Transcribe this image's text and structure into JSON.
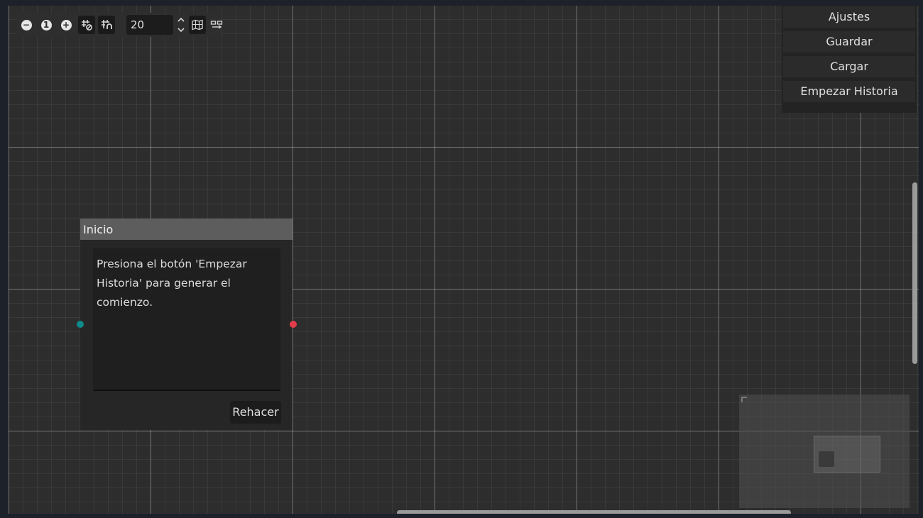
{
  "toolbar": {
    "zoom_out_icon": "minus-circle-icon",
    "zoom_reset_label": "1",
    "zoom_in_icon": "plus-circle-icon",
    "snap_distance": "20"
  },
  "menu": {
    "items": [
      "Ajustes",
      "Guardar",
      "Cargar",
      "Empezar Historia"
    ]
  },
  "node": {
    "title": "Inicio",
    "text": "Presiona el botón 'Empezar Historia' para generar el comienzo.",
    "button_label": "Rehacer"
  },
  "colors": {
    "input_port": "#0e8a8a",
    "output_port": "#e03c4a",
    "background": "#2d2d2d"
  }
}
